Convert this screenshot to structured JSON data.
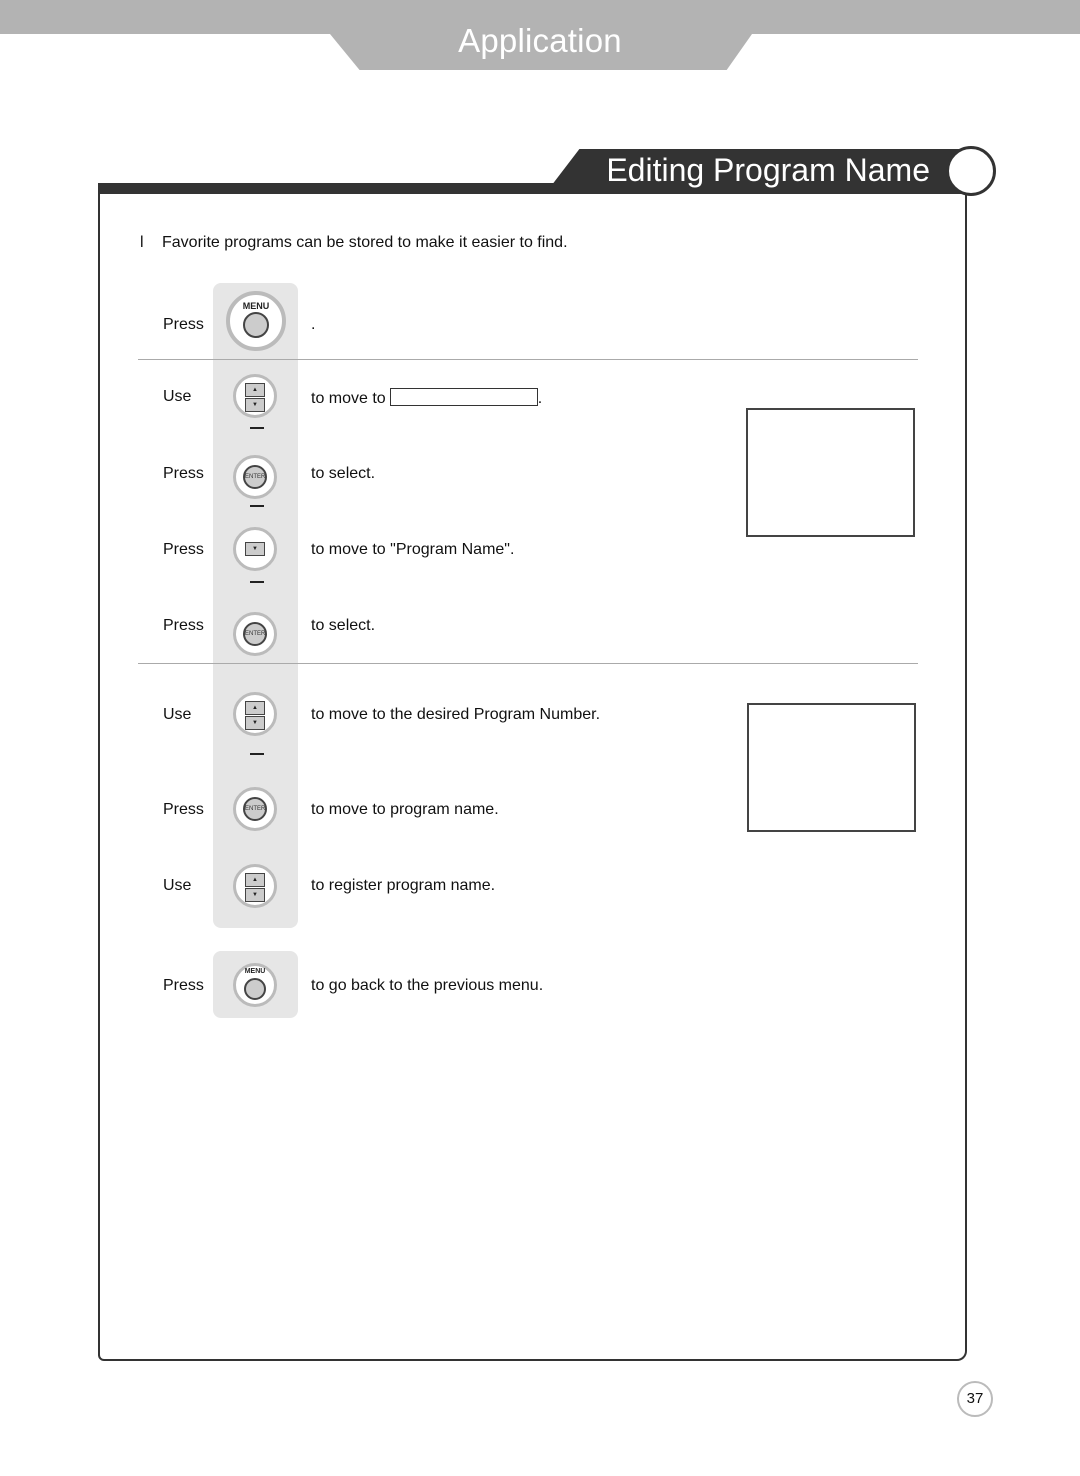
{
  "header": {
    "title": "Application"
  },
  "section": {
    "title": "Editing Program Name"
  },
  "intro": {
    "bullet": "l",
    "text": "Favorite programs can be stored to make it easier to find."
  },
  "buttons": {
    "menu": "MENU",
    "enter": "ENTER",
    "pr_up": "▲",
    "pr_down": "▼"
  },
  "steps": [
    {
      "verb": "Press",
      "button": "menu",
      "desc": "."
    },
    {
      "verb": "Use",
      "button": "pr-up-down",
      "desc": "to move to",
      "trailing": "."
    },
    {
      "verb": "Press",
      "button": "enter",
      "desc": "to select."
    },
    {
      "verb": "Press",
      "button": "pr-down",
      "desc": "to move to \"Program Name\"."
    },
    {
      "verb": "Press",
      "button": "enter",
      "desc": "to select."
    },
    {
      "verb": "Use",
      "button": "pr-up-down",
      "desc": "to  move to the desired Program Number."
    },
    {
      "verb": "Press",
      "button": "enter",
      "desc": "to move to program name."
    },
    {
      "verb": "Use",
      "button": "pr-up-down",
      "desc": "to register program name."
    },
    {
      "verb": "Press",
      "button": "menu",
      "desc": "to go back to the previous menu."
    }
  ],
  "page_number": "37"
}
